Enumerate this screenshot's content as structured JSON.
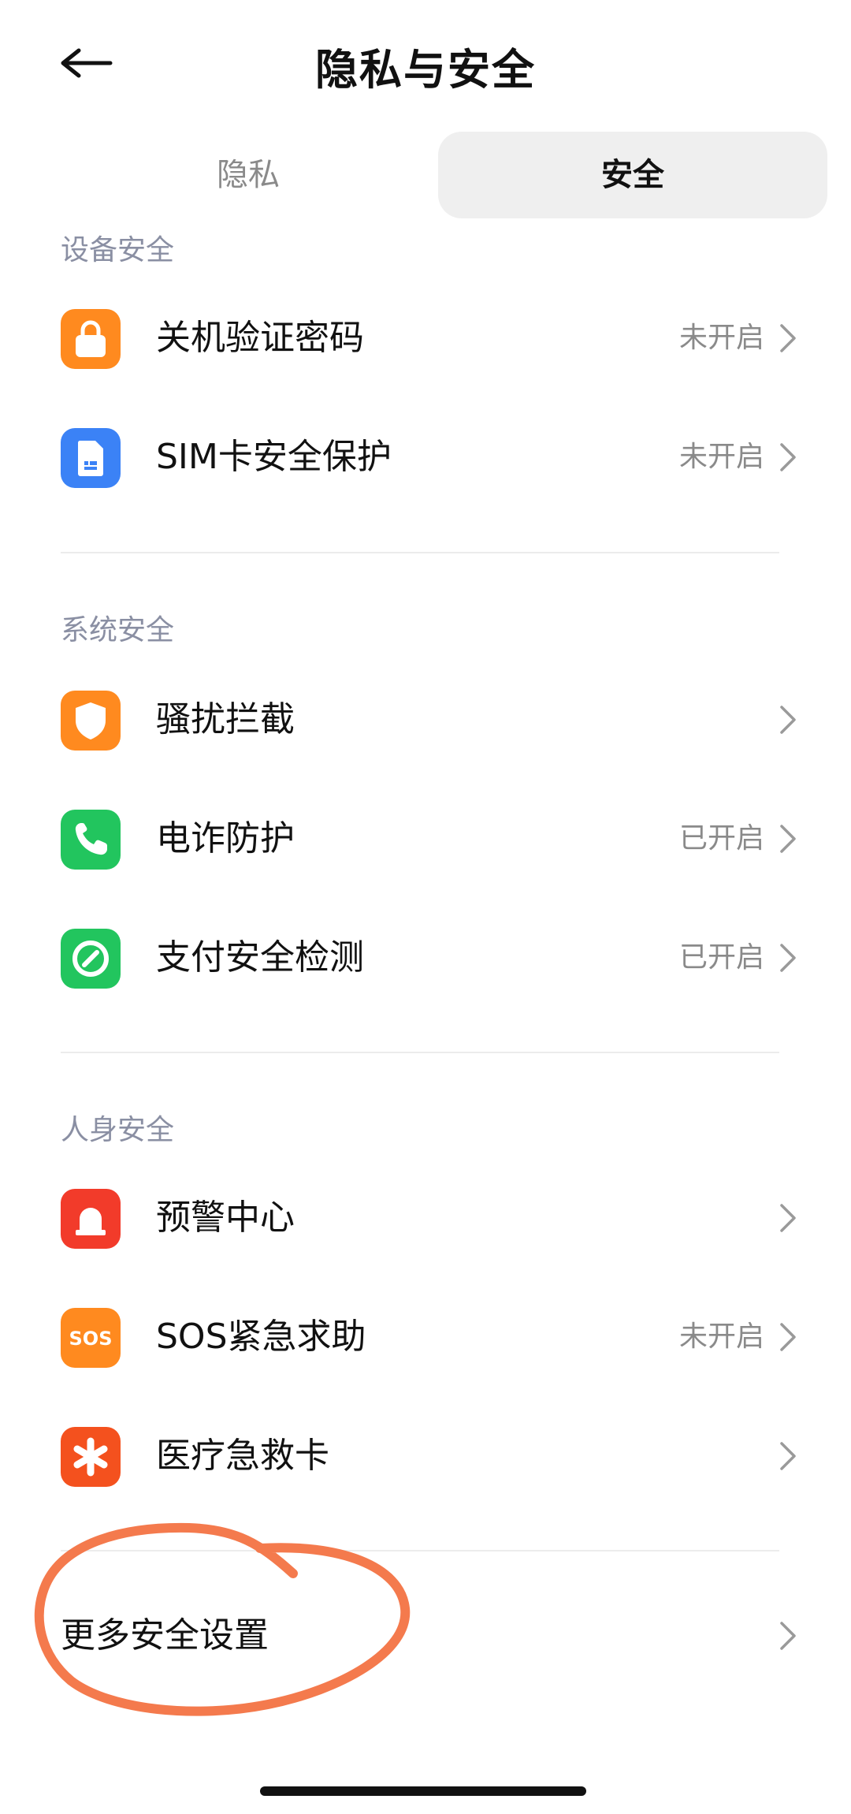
{
  "header": {
    "title": "隐私与安全",
    "back_icon": "arrow-left-icon"
  },
  "tabs": [
    {
      "label": "隐私",
      "selected": false
    },
    {
      "label": "安全",
      "selected": true
    }
  ],
  "sections": [
    {
      "title": "设备安全",
      "items": [
        {
          "label": "关机验证密码",
          "status": "未开启",
          "icon": "lock-icon",
          "icon_color": "#FF8A1F"
        },
        {
          "label": "SIM卡安全保护",
          "status": "未开启",
          "icon": "sim-card-icon",
          "icon_color": "#3B82F6"
        }
      ]
    },
    {
      "title": "系统安全",
      "items": [
        {
          "label": "骚扰拦截",
          "status": "",
          "icon": "shield-icon",
          "icon_color": "#FF8A1F"
        },
        {
          "label": "电诈防护",
          "status": "已开启",
          "icon": "phone-icon",
          "icon_color": "#22C55E"
        },
        {
          "label": "支付安全检测",
          "status": "已开启",
          "icon": "payment-check-icon",
          "icon_color": "#22C55E"
        }
      ]
    },
    {
      "title": "人身安全",
      "items": [
        {
          "label": "预警中心",
          "status": "",
          "icon": "alarm-icon",
          "icon_color": "#F23B2A"
        },
        {
          "label": "SOS紧急求助",
          "status": "未开启",
          "icon": "sos-icon",
          "icon_color": "#FF8A1F",
          "icon_text": "SOS"
        },
        {
          "label": "医疗急救卡",
          "status": "",
          "icon": "medical-star-icon",
          "icon_color": "#F4511E"
        }
      ]
    }
  ],
  "more": {
    "label": "更多安全设置"
  },
  "annotation": {
    "circle_color": "#F47A4D",
    "icon": "hand-drawn-circle-icon"
  }
}
